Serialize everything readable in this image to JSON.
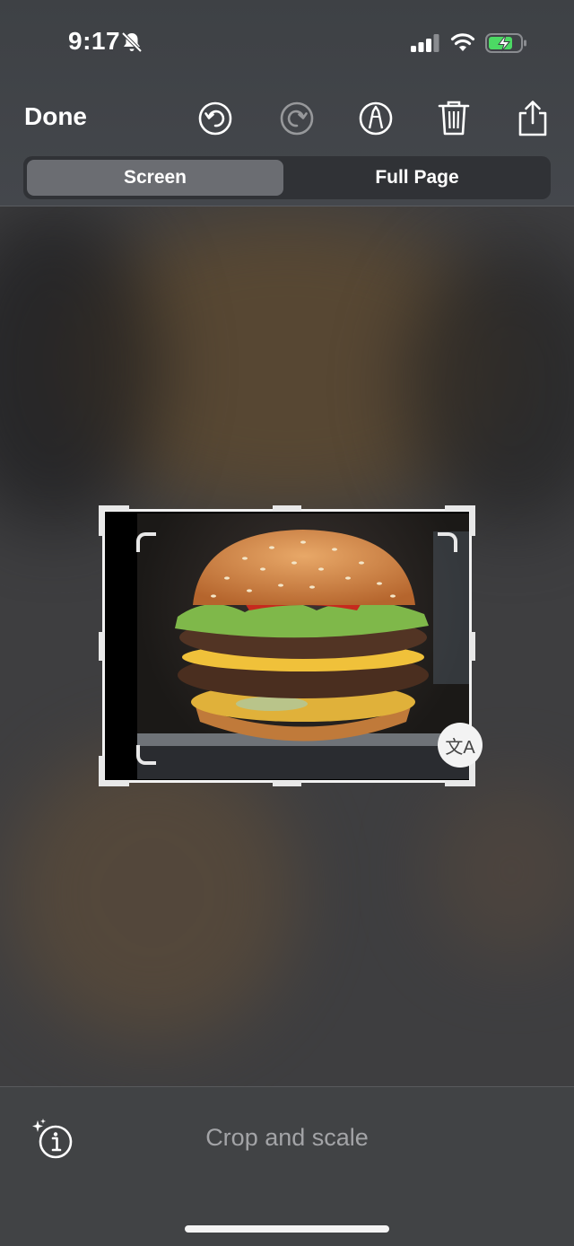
{
  "status_bar": {
    "time": "9:17"
  },
  "toolbar": {
    "done_label": "Done"
  },
  "segments": {
    "screen": "Screen",
    "full_page": "Full Page",
    "selected": "Screen"
  },
  "bottom_bar": {
    "mode_label": "Crop and scale"
  },
  "translate_glyph": "文A",
  "icons": [
    "bell-slash-icon",
    "cellular-signal-icon",
    "wifi-icon",
    "battery-charging-icon",
    "undo-icon",
    "redo-icon",
    "markup-pen-icon",
    "trash-icon",
    "share-icon",
    "translate-icon",
    "visual-lookup-icon"
  ],
  "colors": {
    "battery_green": "#4cd964",
    "selected_segment": "#6b6d72"
  }
}
